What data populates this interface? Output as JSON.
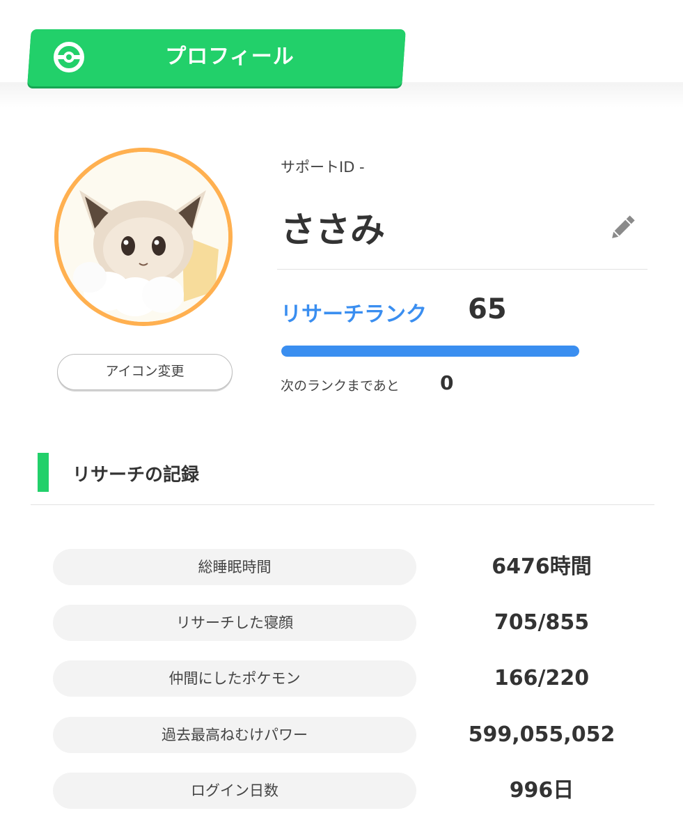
{
  "header": {
    "title": "プロフィール",
    "icon": "pokeball-icon"
  },
  "profile": {
    "avatar_icon": "eevee-avatar",
    "change_icon_label": "アイコン変更",
    "support_id": "サポートID -",
    "name": "ささみ",
    "edit_icon": "pencil-icon"
  },
  "rank": {
    "label": "リサーチランク",
    "value": "65",
    "progress": 1.0,
    "next_label": "次のランクまであと",
    "next_value": "0"
  },
  "records": {
    "section_title": "リサーチの記録",
    "rows": [
      {
        "label": "総睡眠時間",
        "value": "6476時間"
      },
      {
        "label": "リサーチした寝顔",
        "value": "705/855"
      },
      {
        "label": "仲間にしたポケモン",
        "value": "166/220"
      },
      {
        "label": "過去最高ねむけパワー",
        "value": "599,055,052"
      },
      {
        "label": "ログイン日数",
        "value": "996日"
      }
    ]
  },
  "colors": {
    "brand_green": "#22d06a",
    "rank_blue": "#3a8ef0",
    "avatar_ring": "#ffb050"
  }
}
